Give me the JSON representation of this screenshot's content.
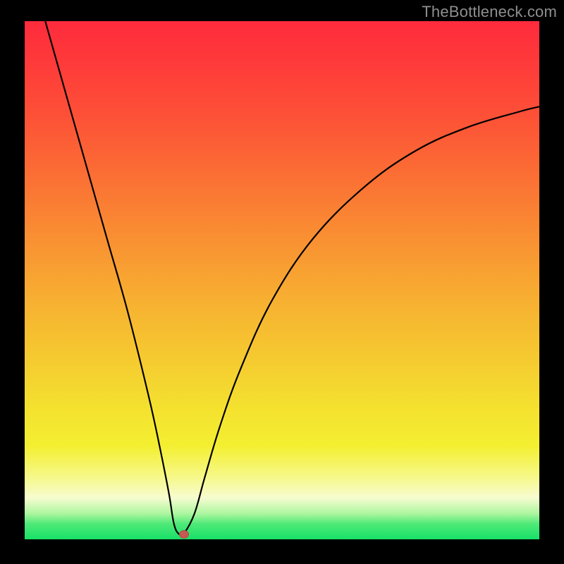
{
  "watermark": "TheBottleneck.com",
  "colors": {
    "curve": "#000000",
    "marker": "#c55a52"
  },
  "chart_data": {
    "type": "line",
    "title": "",
    "xlabel": "",
    "ylabel": "",
    "xlim": [
      0,
      100
    ],
    "ylim": [
      0,
      100
    ],
    "grid": false,
    "legend_pos": "none",
    "note": "No numeric axis ticks or labels are rendered; values are read as percentages of plot width/height (0 = bottom/left).",
    "series": [
      {
        "name": "curve",
        "x": [
          4,
          8,
          12,
          16,
          20,
          24,
          26,
          28,
          29,
          30,
          31,
          33,
          35,
          38,
          42,
          48,
          56,
          66,
          76,
          86,
          96,
          100
        ],
        "values": [
          100,
          86,
          72,
          58,
          44,
          28,
          19,
          9,
          3,
          1,
          1.2,
          5,
          12,
          22,
          33,
          46,
          58,
          68,
          75,
          79.5,
          82.5,
          83.5
        ]
      }
    ],
    "marker": {
      "x": 31,
      "y": 1
    }
  }
}
